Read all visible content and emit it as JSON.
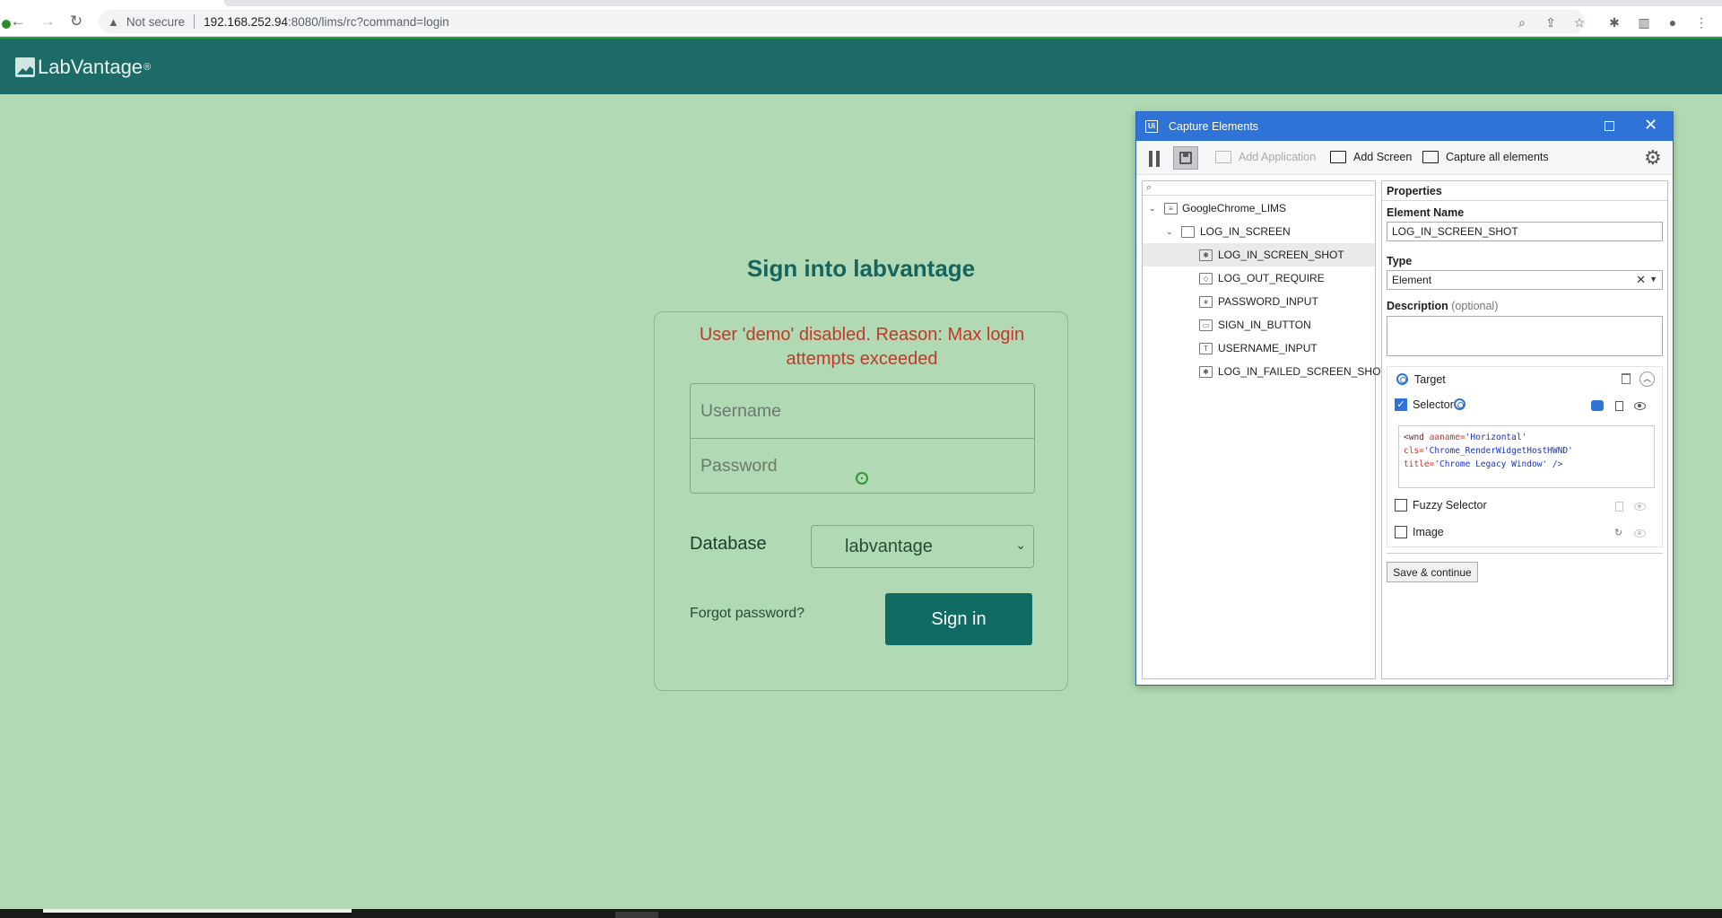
{
  "browser": {
    "security_label": "Not secure",
    "url_host": "192.168.252.94",
    "url_path": ":8080/lims/rc?command=login",
    "icons": [
      "back-icon",
      "forward-icon",
      "reload-icon",
      "warning-icon",
      "zoom-icon",
      "share-icon",
      "star-icon",
      "extensions-icon",
      "sidepanel-icon",
      "profile-icon",
      "menu-icon"
    ]
  },
  "app": {
    "brand": "LabVantage",
    "brand_mark": "®"
  },
  "login": {
    "title": "Sign into labvantage",
    "error": "User 'demo' disabled. Reason: Max login attempts exceeded",
    "username_placeholder": "Username",
    "password_placeholder": "Password",
    "database_label": "Database",
    "database_value": "labvantage",
    "forgot_label": "Forgot password?",
    "signin_label": "Sign in"
  },
  "dialog": {
    "title": "Capture Elements",
    "toolbar": {
      "add_application": "Add Application",
      "add_screen": "Add Screen",
      "capture_all": "Capture all elements"
    },
    "tree": [
      {
        "label": "GoogleChrome_LIMS",
        "icon": "app-window-icon"
      },
      {
        "label": "LOG_IN_SCREEN",
        "icon": "screen-icon"
      },
      {
        "label": "LOG_IN_SCREEN_SHOT",
        "icon": "asterisk-element-icon"
      },
      {
        "label": "LOG_OUT_REQUIRE",
        "icon": "tag-element-icon"
      },
      {
        "label": "PASSWORD_INPUT",
        "icon": "password-field-icon"
      },
      {
        "label": "SIGN_IN_BUTTON",
        "icon": "button-element-icon"
      },
      {
        "label": "USERNAME_INPUT",
        "icon": "text-field-icon"
      },
      {
        "label": "LOG_IN_FAILED_SCREEN_SHOT",
        "icon": "asterisk-element-icon"
      }
    ],
    "properties": {
      "header": "Properties",
      "element_name_label": "Element Name",
      "element_name_value": "LOG_IN_SCREEN_SHOT",
      "type_label": "Type",
      "type_value": "Element",
      "description_label": "Description",
      "description_optional": "(optional)",
      "target_label": "Target",
      "selector_label": "Selector",
      "selector_code": {
        "l1_tag": "<wnd",
        "l1_attr": "aaname=",
        "l1_val": "'Horizontal'",
        "l2_attr": "cls=",
        "l2_val": "'Chrome_RenderWidgetHostHWND'",
        "l3_attr": "title=",
        "l3_val": "'Chrome Legacy Window'",
        "l3_end": " />"
      },
      "fuzzy_selector_label": "Fuzzy Selector",
      "image_label": "Image",
      "save_continue_label": "Save & continue"
    }
  }
}
